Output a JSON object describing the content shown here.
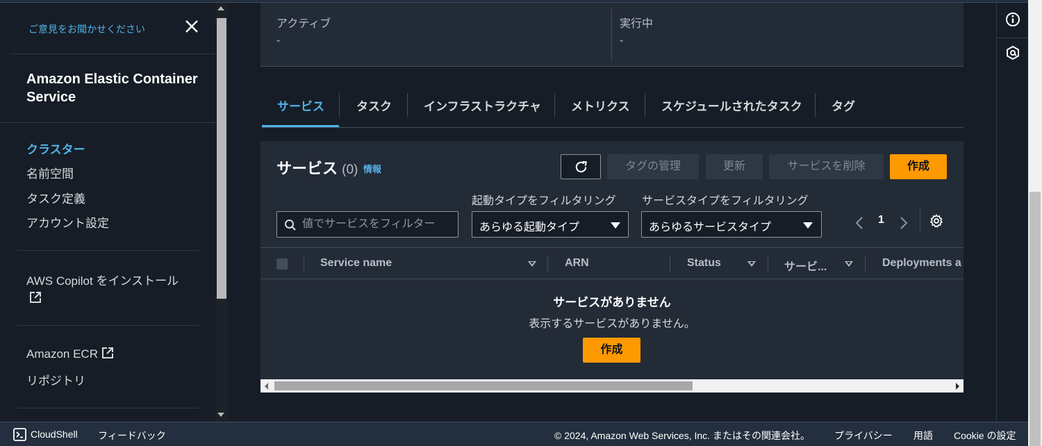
{
  "sidebar": {
    "feedback": "ご意見をお聞かせください",
    "title": "Amazon Elastic Container Service",
    "nav": [
      "クラスター",
      "名前空間",
      "タスク定義",
      "アカウント設定"
    ],
    "copilot": "AWS Copilot をインストール",
    "ecr": "Amazon ECR",
    "repos": "リポジトリ"
  },
  "status": {
    "active_label": "アクティブ",
    "active_value": "-",
    "running_label": "実行中",
    "running_value": "-"
  },
  "tabs": [
    "サービス",
    "タスク",
    "インフラストラクチャ",
    "メトリクス",
    "スケジュールされたタスク",
    "タグ"
  ],
  "services_panel": {
    "title": "サービス",
    "count": "(0)",
    "info": "情報",
    "buttons": {
      "manage_tags": "タグの管理",
      "update": "更新",
      "delete": "サービスを削除",
      "create": "作成"
    },
    "filter_launch_label": "起動タイプをフィルタリング",
    "filter_service_label": "サービスタイプをフィルタリング",
    "search_placeholder": "値でサービスをフィルター",
    "launch_select": "あらゆる起動タイプ",
    "service_select": "あらゆるサービスタイプ",
    "page": "1",
    "columns": [
      "Service name",
      "ARN",
      "Status",
      "サービ...",
      "Deployments a"
    ],
    "empty_title": "サービスがありません",
    "empty_desc": "表示するサービスがありません。",
    "empty_create": "作成"
  },
  "footer": {
    "cloudshell": "CloudShell",
    "feedback": "フィードバック",
    "copyright": "© 2024, Amazon Web Services, Inc. またはその関連会社。",
    "privacy": "プライバシー",
    "terms": "用語",
    "cookie": "Cookie の設定"
  },
  "colors": {
    "accent": "#53b2e8",
    "primary_button": "#ff9900",
    "background": "#161d26",
    "panel": "#232b37"
  },
  "icons": [
    "close-icon",
    "external-link-icon",
    "refresh-icon",
    "search-icon",
    "chevron-left-icon",
    "chevron-right-icon",
    "gear-icon",
    "info-icon",
    "settings-hex-icon",
    "cloudshell-icon"
  ]
}
